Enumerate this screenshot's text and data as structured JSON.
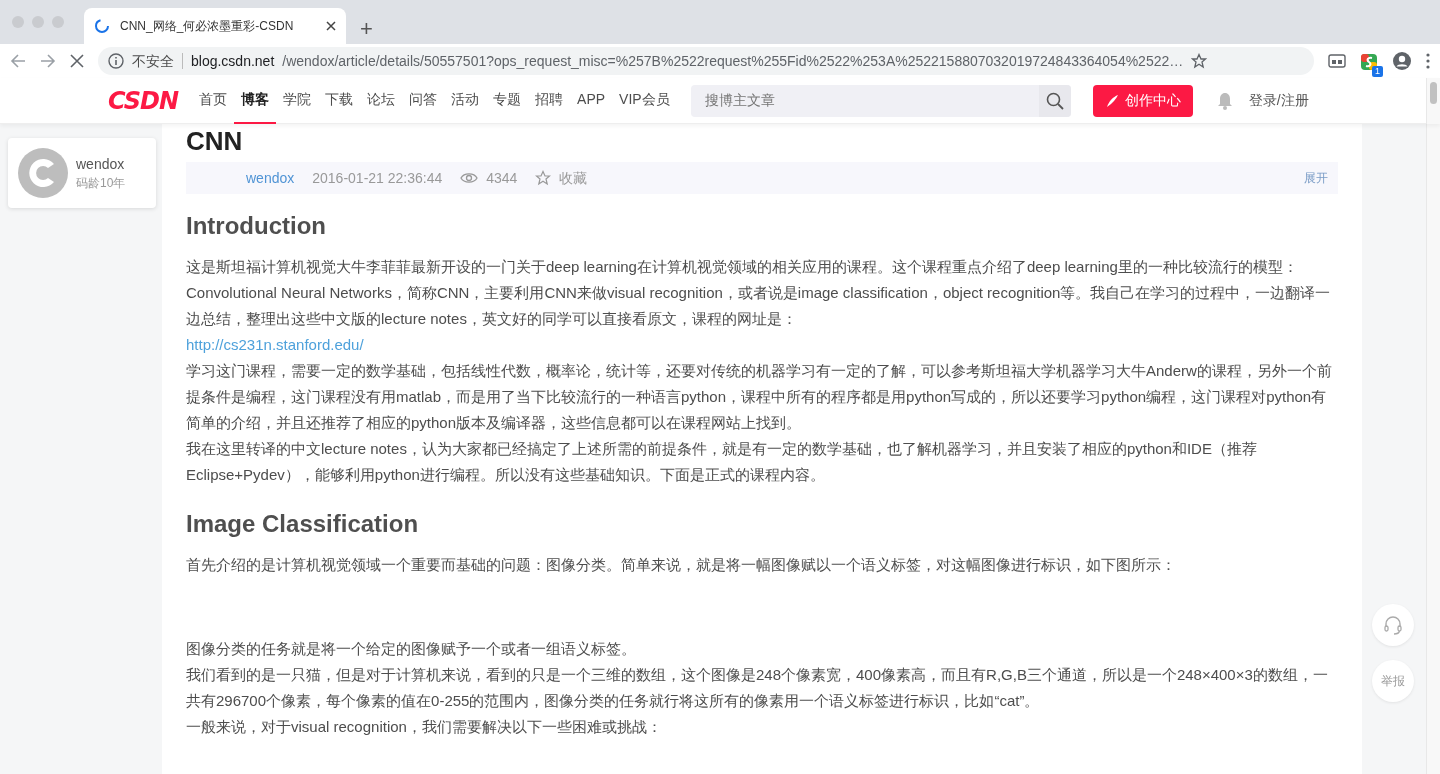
{
  "browser": {
    "tab_title": "CNN_网络_何必浓墨重彩-CSDN",
    "new_tab": "+",
    "security": "不安全",
    "url_host": "blog.csdn.net",
    "url_rest": "/wendox/article/details/50557501?ops_request_misc=%257B%2522request%255Fid%2522%253A%2522158807032019724843364054%2522…",
    "extension_badge": "1"
  },
  "site_nav": {
    "logo": "CSDN",
    "items": [
      {
        "label": "首页",
        "selected": false
      },
      {
        "label": "博客",
        "selected": true
      },
      {
        "label": "学院",
        "selected": false
      },
      {
        "label": "下载",
        "selected": false
      },
      {
        "label": "论坛",
        "selected": false
      },
      {
        "label": "问答",
        "selected": false
      },
      {
        "label": "活动",
        "selected": false
      },
      {
        "label": "专题",
        "selected": false
      },
      {
        "label": "招聘",
        "selected": false
      },
      {
        "label": "APP",
        "selected": false
      },
      {
        "label": "VIP会员",
        "selected": false
      }
    ],
    "search": {
      "placeholder": "搜博主文章"
    },
    "create_button": "创作中心",
    "login": "登录/注册"
  },
  "profile_card": {
    "name": "wendox",
    "years": "码龄10年"
  },
  "article": {
    "title": "CNN",
    "meta": {
      "author": "wendox",
      "date": "2016-01-21 22:36:44",
      "views": "4344",
      "collect": "收藏",
      "expand": "展开"
    },
    "blocks": [
      {
        "kind": "heading",
        "text": "Introduction"
      },
      {
        "kind": "para",
        "text": "这是斯坦福计算机视觉大牛李菲菲最新开设的一门关于deep learning在计算机视觉领域的相关应用的课程。这个课程重点介绍了deep learning里的一种比较流行的模型：Convolutional Neural Networks，简称CNN，主要利用CNN来做visual recognition，或者说是image classification，object recognition等。我自己在学习的过程中，一边翻译一边总结，整理出这些中文版的lecture notes，英文好的同学可以直接看原文，课程的网址是："
      },
      {
        "kind": "link",
        "text": "http://cs231n.stanford.edu/"
      },
      {
        "kind": "para",
        "text": "学习这门课程，需要一定的数学基础，包括线性代数，概率论，统计等，还要对传统的机器学习有一定的了解，可以参考斯坦福大学机器学习大牛Anderw的课程，另外一个前提条件是编程，这门课程没有用matlab，而是用了当下比较流行的一种语言python，课程中所有的程序都是用python写成的，所以还要学习python编程，这门课程对python有简单的介绍，并且还推荐了相应的python版本及编译器，这些信息都可以在课程网站上找到。"
      },
      {
        "kind": "para",
        "text": "我在这里转译的中文lecture notes，认为大家都已经搞定了上述所需的前提条件，就是有一定的数学基础，也了解机器学习，并且安装了相应的python和IDE（推荐Eclipse+Pydev），能够利用python进行编程。所以没有这些基础知识。下面是正式的课程内容。"
      },
      {
        "kind": "heading",
        "text": "Image Classification"
      },
      {
        "kind": "para",
        "text": "首先介绍的是计算机视觉领域一个重要而基础的问题：图像分类。简单来说，就是将一幅图像赋以一个语义标签，对这幅图像进行标识，如下图所示："
      },
      {
        "kind": "gap"
      },
      {
        "kind": "para",
        "text": "图像分类的任务就是将一个给定的图像赋予一个或者一组语义标签。"
      },
      {
        "kind": "para",
        "text": "我们看到的是一只猫，但是对于计算机来说，看到的只是一个三维的数组，这个图像是248个像素宽，400像素高，而且有R,G,B三个通道，所以是一个248×400×3的数组，一共有296700个像素，每个像素的值在0-255的范围内，图像分类的任务就行将这所有的像素用一个语义标签进行标识，比如“cat”。"
      },
      {
        "kind": "para",
        "text": "一般来说，对于visual recognition，我们需要解决以下一些困难或挑战："
      }
    ]
  },
  "side_tools": {
    "report": "举报"
  }
}
